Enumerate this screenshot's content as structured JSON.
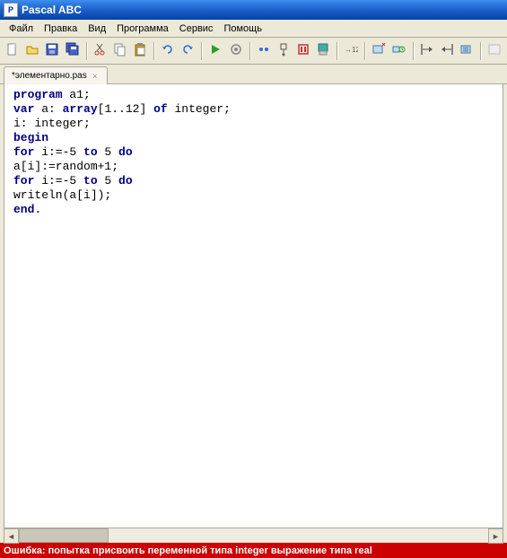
{
  "window": {
    "title": "Pascal ABC",
    "icon_letter": "P"
  },
  "menu": {
    "items": [
      "Файл",
      "Правка",
      "Вид",
      "Программа",
      "Сервис",
      "Помощь"
    ]
  },
  "toolbar": {
    "icons": [
      "new-file",
      "open-file",
      "save",
      "save-all",
      "sep",
      "cut",
      "copy",
      "paste",
      "sep",
      "undo",
      "redo",
      "sep",
      "run",
      "step",
      "sep",
      "trace-into",
      "trace-over",
      "stop",
      "watch",
      "sep",
      "goto-line",
      "sep",
      "back",
      "forward",
      "sep",
      "comment",
      "uncomment",
      "indent",
      "sep",
      "blank"
    ]
  },
  "tab": {
    "label": "*элементарно.pas"
  },
  "code": {
    "lines": [
      [
        [
          "kw",
          "program"
        ],
        [
          "pl",
          " a1;"
        ]
      ],
      [
        [
          "kw",
          "var"
        ],
        [
          "pl",
          " a: "
        ],
        [
          "kw",
          "array"
        ],
        [
          "pl",
          "[1..12] "
        ],
        [
          "kw",
          "of"
        ],
        [
          "pl",
          " integer;"
        ]
      ],
      [
        [
          "pl",
          "i: integer;"
        ]
      ],
      [
        [
          "kw",
          "begin"
        ]
      ],
      [
        [
          "kw",
          "for"
        ],
        [
          "pl",
          " i:=-5 "
        ],
        [
          "kw",
          "to"
        ],
        [
          "pl",
          " 5 "
        ],
        [
          "kw",
          "do"
        ]
      ],
      [
        [
          "pl",
          "a[i]:=random+1;"
        ]
      ],
      [
        [
          "kw",
          "for"
        ],
        [
          "pl",
          " i:=-5 "
        ],
        [
          "kw",
          "to"
        ],
        [
          "pl",
          " 5 "
        ],
        [
          "kw",
          "do"
        ]
      ],
      [
        [
          "pl",
          "writeln(a[i]);"
        ]
      ],
      [
        [
          "kw",
          "end"
        ],
        [
          "pl",
          "."
        ]
      ]
    ]
  },
  "error": {
    "text": "Ошибка: попытка присвоить переменной типа integer выражение типа real"
  }
}
